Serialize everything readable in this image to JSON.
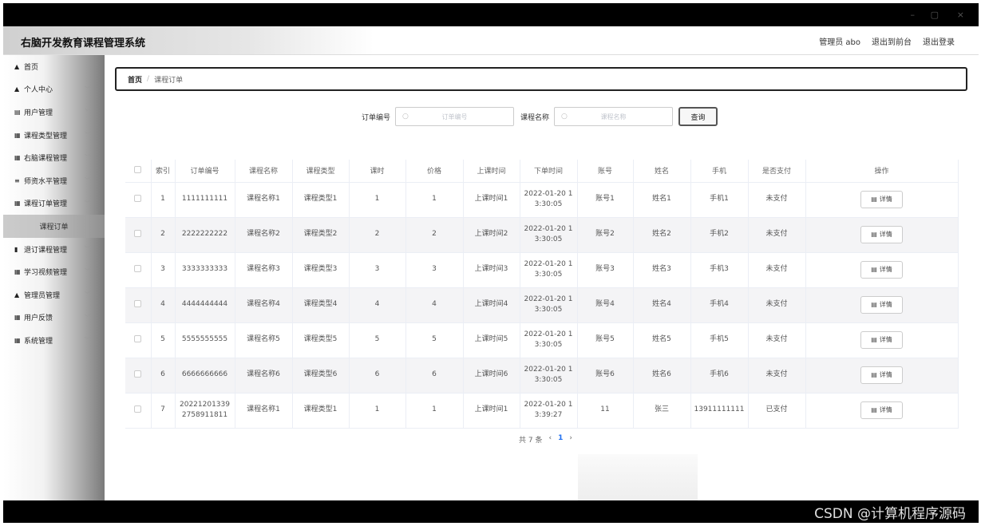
{
  "window": {
    "minimize": "–",
    "maximize": "▢",
    "close": "×"
  },
  "header": {
    "title": "右脑开发教育课程管理系统",
    "admin_label": "管理员 abo",
    "to_front": "退出到前台",
    "logout": "退出登录"
  },
  "sidebar": {
    "items": [
      {
        "label": "首页",
        "icon": "home-icon",
        "glyph": "▲"
      },
      {
        "label": "个人中心",
        "icon": "user-icon",
        "glyph": "▲"
      },
      {
        "label": "用户管理",
        "icon": "list-icon",
        "glyph": "▤"
      },
      {
        "label": "课程类型管理",
        "icon": "grid-icon",
        "glyph": "▦"
      },
      {
        "label": "右脑课程管理",
        "icon": "grid-icon",
        "glyph": "▦"
      },
      {
        "label": "师资水平管理",
        "icon": "scale-icon",
        "glyph": "≡"
      },
      {
        "label": "课程订单管理",
        "icon": "grid-icon",
        "glyph": "▦"
      },
      {
        "label": "课程订单",
        "icon": "",
        "glyph": ""
      },
      {
        "label": "退订课程管理",
        "icon": "trash-icon",
        "glyph": "▮"
      },
      {
        "label": "学习视频管理",
        "icon": "grid-icon",
        "glyph": "▦"
      },
      {
        "label": "管理员管理",
        "icon": "lock-icon",
        "glyph": "▲"
      },
      {
        "label": "用户反馈",
        "icon": "grid-icon",
        "glyph": "▦"
      },
      {
        "label": "系统管理",
        "icon": "grid-icon",
        "glyph": "▦"
      }
    ]
  },
  "breadcrumb": {
    "home": "首页",
    "separator": "/",
    "current": "课程订单"
  },
  "search": {
    "order_no_label": "订单编号",
    "order_no_placeholder": "订单编号",
    "course_name_label": "课程名称",
    "course_name_placeholder": "课程名称",
    "query_button": "查询"
  },
  "table": {
    "headers": [
      "索引",
      "订单编号",
      "课程名称",
      "课程类型",
      "课时",
      "价格",
      "上课时间",
      "下单时间",
      "账号",
      "姓名",
      "手机",
      "是否支付",
      "操作"
    ],
    "detail_label": "详情",
    "rows": [
      [
        "1",
        "1111111111",
        "课程名称1",
        "课程类型1",
        "1",
        "1",
        "上课时间1",
        "2022-01-20 1\n3:30:05",
        "账号1",
        "姓名1",
        "手机1",
        "未支付"
      ],
      [
        "2",
        "2222222222",
        "课程名称2",
        "课程类型2",
        "2",
        "2",
        "上课时间2",
        "2022-01-20 1\n3:30:05",
        "账号2",
        "姓名2",
        "手机2",
        "未支付"
      ],
      [
        "3",
        "3333333333",
        "课程名称3",
        "课程类型3",
        "3",
        "3",
        "上课时间3",
        "2022-01-20 1\n3:30:05",
        "账号3",
        "姓名3",
        "手机3",
        "未支付"
      ],
      [
        "4",
        "4444444444",
        "课程名称4",
        "课程类型4",
        "4",
        "4",
        "上课时间4",
        "2022-01-20 1\n3:30:05",
        "账号4",
        "姓名4",
        "手机4",
        "未支付"
      ],
      [
        "5",
        "5555555555",
        "课程名称5",
        "课程类型5",
        "5",
        "5",
        "上课时间5",
        "2022-01-20 1\n3:30:05",
        "账号5",
        "姓名5",
        "手机5",
        "未支付"
      ],
      [
        "6",
        "6666666666",
        "课程名称6",
        "课程类型6",
        "6",
        "6",
        "上课时间6",
        "2022-01-20 1\n3:30:05",
        "账号6",
        "姓名6",
        "手机6",
        "未支付"
      ],
      [
        "7",
        "20221201339\n2758911811",
        "课程名称1",
        "课程类型1",
        "1",
        "1",
        "上课时间1",
        "2022-01-20 1\n3:39:27",
        "11",
        "张三",
        "13911111111",
        "已支付"
      ]
    ]
  },
  "pager": {
    "total": "共 7 条",
    "prev": "‹",
    "page": "1",
    "next": "›"
  },
  "watermark": "CSDN @计算机程序源码"
}
